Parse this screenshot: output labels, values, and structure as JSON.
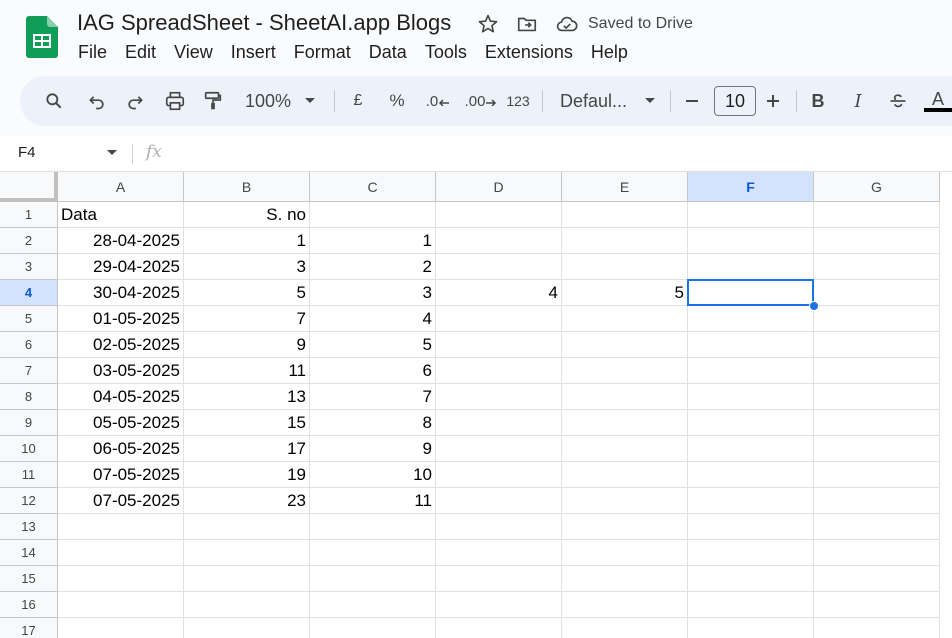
{
  "doc": {
    "title": "IAG SpreadSheet - SheetAI.app Blogs",
    "saved_status": "Saved to Drive"
  },
  "icons": {
    "star": "star-icon",
    "move": "move-to-folder-icon",
    "cloud": "cloud-saved-icon",
    "logo": "google-sheets-logo"
  },
  "menu": [
    "File",
    "Edit",
    "View",
    "Insert",
    "Format",
    "Data",
    "Tools",
    "Extensions",
    "Help"
  ],
  "toolbar": {
    "zoom": "100%",
    "currency": "£",
    "percent": "%",
    "decrease_decimal": ".0",
    "increase_decimal": ".00",
    "more_formats": "123",
    "font": "Defaul...",
    "font_size": "10",
    "bold": "B",
    "italic": "I",
    "text_color": "A"
  },
  "formula_bar": {
    "name_box": "F4",
    "fx": "fx",
    "value": ""
  },
  "grid": {
    "columns": [
      "A",
      "B",
      "C",
      "D",
      "E",
      "F",
      "G"
    ],
    "selected_column": "F",
    "selected_row": "4",
    "rows": [
      {
        "num": "1",
        "cells": [
          "Data",
          "S. no",
          "",
          "",
          "",
          "",
          ""
        ]
      },
      {
        "num": "2",
        "cells": [
          "28-04-2025",
          "1",
          "1",
          "",
          "",
          "",
          ""
        ]
      },
      {
        "num": "3",
        "cells": [
          "29-04-2025",
          "3",
          "2",
          "",
          "",
          "",
          ""
        ]
      },
      {
        "num": "4",
        "cells": [
          "30-04-2025",
          "5",
          "3",
          "4",
          "5",
          "",
          ""
        ]
      },
      {
        "num": "5",
        "cells": [
          "01-05-2025",
          "7",
          "4",
          "",
          "",
          "",
          ""
        ]
      },
      {
        "num": "6",
        "cells": [
          "02-05-2025",
          "9",
          "5",
          "",
          "",
          "",
          ""
        ]
      },
      {
        "num": "7",
        "cells": [
          "03-05-2025",
          "11",
          "6",
          "",
          "",
          "",
          ""
        ]
      },
      {
        "num": "8",
        "cells": [
          "04-05-2025",
          "13",
          "7",
          "",
          "",
          "",
          ""
        ]
      },
      {
        "num": "9",
        "cells": [
          "05-05-2025",
          "15",
          "8",
          "",
          "",
          "",
          ""
        ]
      },
      {
        "num": "10",
        "cells": [
          "06-05-2025",
          "17",
          "9",
          "",
          "",
          "",
          ""
        ]
      },
      {
        "num": "11",
        "cells": [
          "07-05-2025",
          "19",
          "10",
          "",
          "",
          "",
          ""
        ]
      },
      {
        "num": "12",
        "cells": [
          "07-05-2025",
          "23",
          "11",
          "",
          "",
          "",
          ""
        ]
      },
      {
        "num": "13",
        "cells": [
          "",
          "",
          "",
          "",
          "",
          "",
          ""
        ]
      },
      {
        "num": "14",
        "cells": [
          "",
          "",
          "",
          "",
          "",
          "",
          ""
        ]
      },
      {
        "num": "15",
        "cells": [
          "",
          "",
          "",
          "",
          "",
          "",
          ""
        ]
      },
      {
        "num": "16",
        "cells": [
          "",
          "",
          "",
          "",
          "",
          "",
          ""
        ]
      },
      {
        "num": "17",
        "cells": [
          "",
          "",
          "",
          "",
          "",
          "",
          ""
        ]
      }
    ]
  },
  "colors": {
    "accent": "#1a73e8",
    "sheets_green": "#0f9d58",
    "selected_header": "#d3e3fd"
  }
}
